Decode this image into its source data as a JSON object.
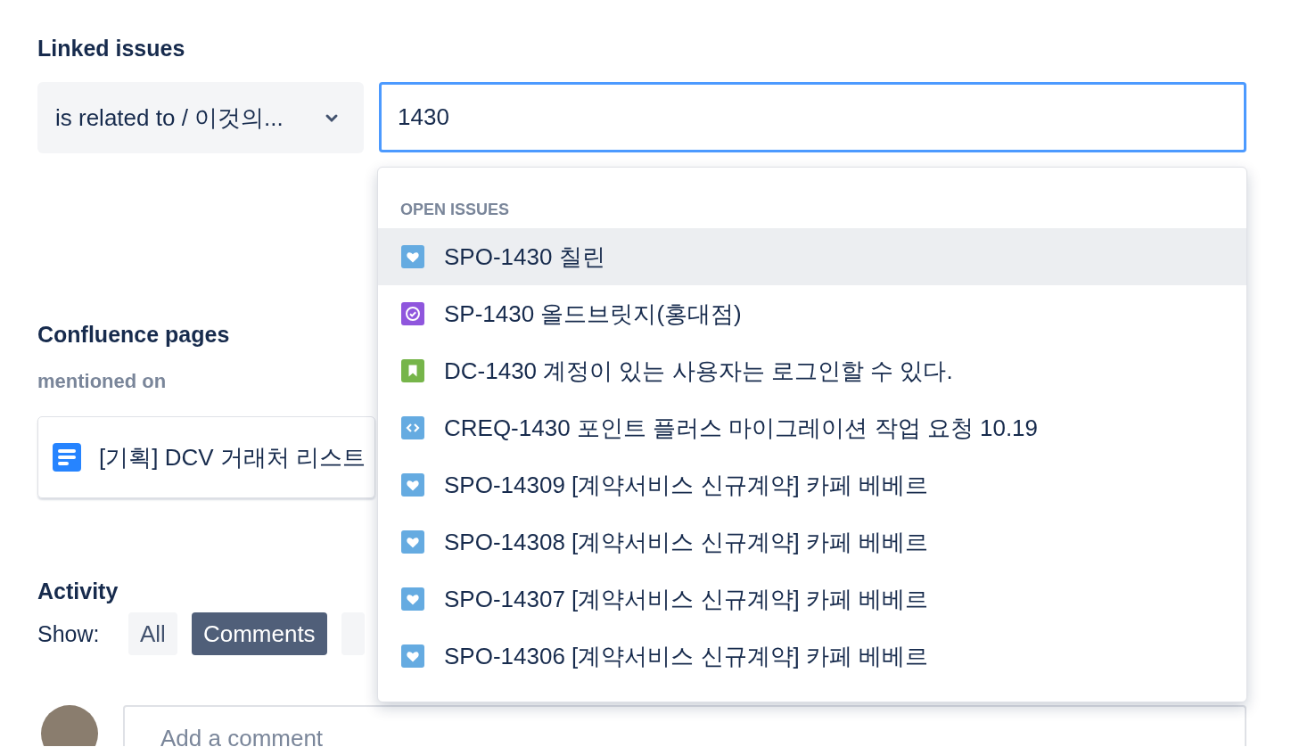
{
  "linked_issues": {
    "title": "Linked issues",
    "relation": {
      "value": "is related to / 이것의..."
    },
    "search": {
      "value": "1430"
    },
    "suggestions": {
      "header": "OPEN ISSUES",
      "items": [
        {
          "kind": "heart",
          "text": "SPO-1430 칠린",
          "selected": true
        },
        {
          "kind": "check",
          "text": "SP-1430 올드브릿지(홍대점)",
          "selected": false
        },
        {
          "kind": "bookmark",
          "text": "DC-1430 계정이 있는 사용자는 로그인할 수 있다.",
          "selected": false
        },
        {
          "kind": "code",
          "text": "CREQ-1430 포인트 플러스 마이그레이션 작업 요청 10.19",
          "selected": false
        },
        {
          "kind": "heart",
          "text": "SPO-14309 [계약서비스 신규계약] 카페 베베르",
          "selected": false
        },
        {
          "kind": "heart",
          "text": "SPO-14308 [계약서비스 신규계약] 카페 베베르",
          "selected": false
        },
        {
          "kind": "heart",
          "text": "SPO-14307 [계약서비스 신규계약] 카페 베베르",
          "selected": false
        },
        {
          "kind": "heart",
          "text": "SPO-14306 [계약서비스 신규계약] 카페 베베르",
          "selected": false
        }
      ]
    }
  },
  "confluence": {
    "title": "Confluence pages",
    "subtitle": "mentioned on",
    "pages": [
      {
        "title": "[기획] DCV 거래처 리스트"
      }
    ]
  },
  "activity": {
    "title": "Activity",
    "show_label": "Show:",
    "filters": [
      {
        "label": "All",
        "selected": false
      },
      {
        "label": "Comments",
        "selected": true
      }
    ],
    "comment": {
      "placeholder": "Add a comment"
    }
  }
}
